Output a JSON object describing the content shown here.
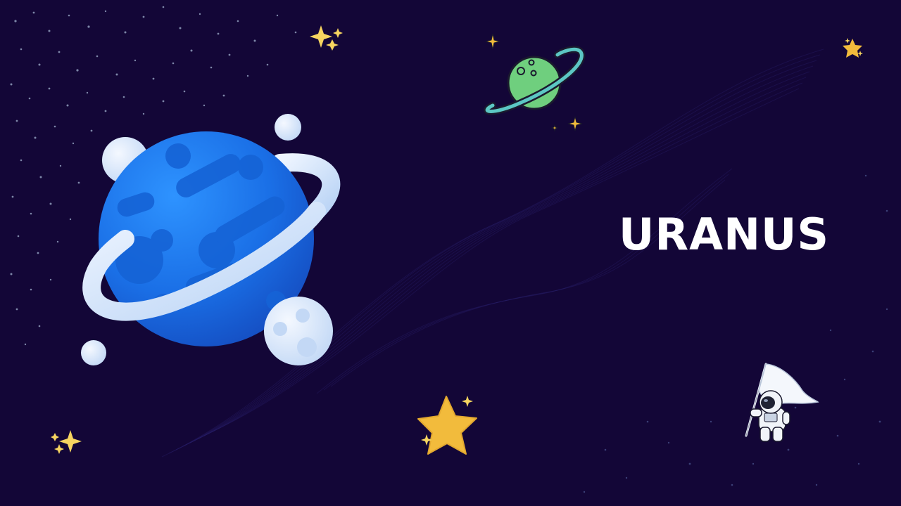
{
  "slide": {
    "title": "URANUS"
  },
  "colors": {
    "background": "#130637",
    "planet_blue": "#1e7cf0",
    "ring": "#d6e6fb",
    "moon": "#e4eefc",
    "saturn_green": "#6fcf7e",
    "saturn_ring": "#5cc7c4",
    "star_gold": "#f2bb3c",
    "sparkle": "#f7d560"
  },
  "icons": [
    "uranus-planet-illustration",
    "saturn-planet-illustration",
    "astronaut-with-flag-illustration",
    "gold-star-icon",
    "sparkle-icon"
  ]
}
